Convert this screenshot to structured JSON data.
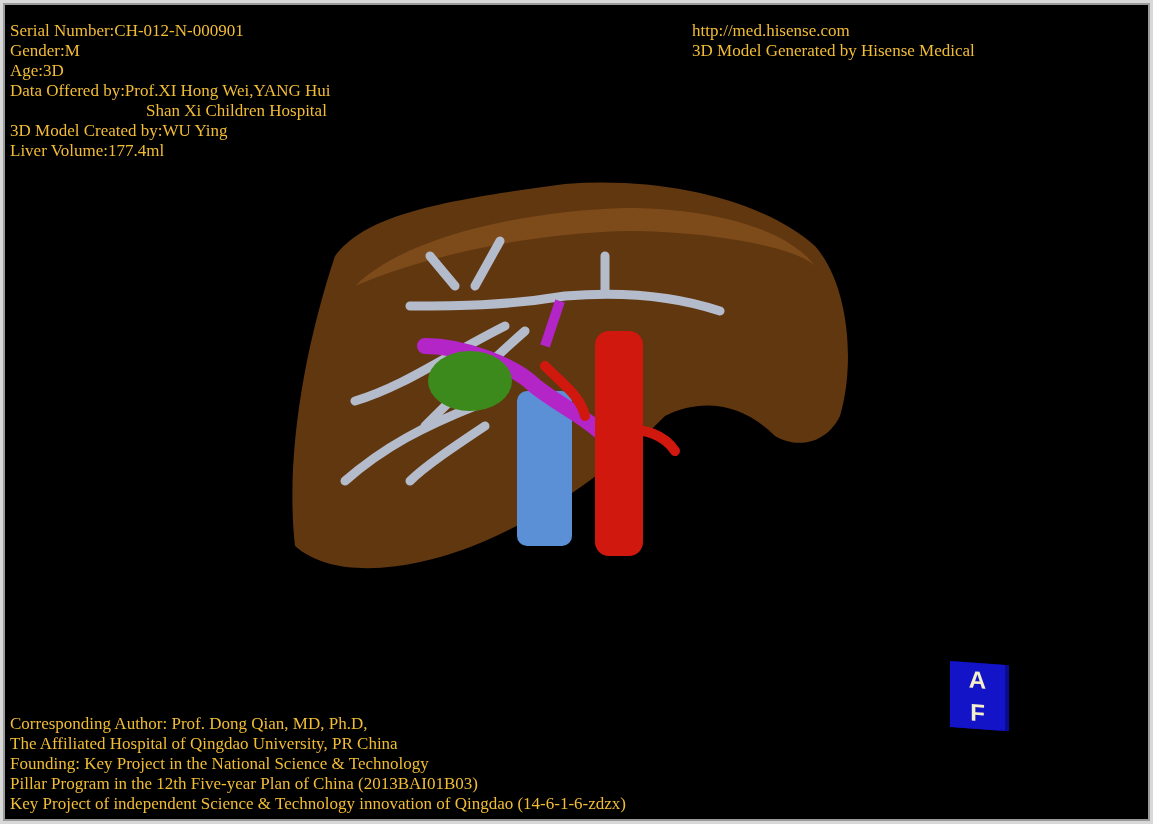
{
  "info_top_left": [
    {
      "text": "Serial Number:CH-012-N-000901",
      "indent": false
    },
    {
      "text": "Gender:M",
      "indent": false
    },
    {
      "text": "Age:3D",
      "indent": false
    },
    {
      "text": "Data Offered by:Prof.XI Hong Wei,YANG Hui",
      "indent": false
    },
    {
      "text": "Shan Xi Children Hospital",
      "indent": true
    },
    {
      "text": "3D Model Created by:WU Ying",
      "indent": false
    },
    {
      "text": "Liver Volume:177.4ml",
      "indent": false
    }
  ],
  "info_top_right": [
    "http://med.hisense.com",
    "3D Model Generated by Hisense Medical"
  ],
  "orientation_cube": {
    "top_label": "A",
    "front_label": "F"
  },
  "credits": [
    "Corresponding Author: Prof. Dong Qian, MD, Ph.D,",
    "The Affiliated Hospital of Qingdao University, PR China",
    "Founding: Key Project in the National Science & Technology",
    "Pillar Program in the 12th Five-year Plan of China (2013BAI01B03)",
    "Key Project of independent Science & Technology innovation of Qingdao (14-6-1-6-zdzx)"
  ]
}
